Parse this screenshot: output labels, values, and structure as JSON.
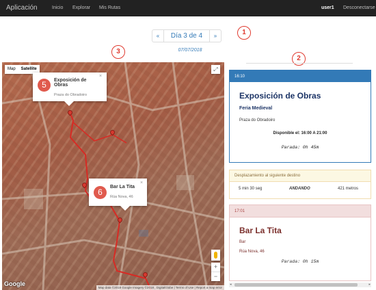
{
  "navbar": {
    "brand": "Aplicación",
    "links": [
      "Inicio",
      "Explorar",
      "Mis Rutas"
    ],
    "user": "user1",
    "logout": "Desconectarse"
  },
  "pager": {
    "prev": "«",
    "label": "Día 3 de 4",
    "next": "»"
  },
  "date": "07/07/2018",
  "callouts": [
    "1",
    "2",
    "3"
  ],
  "map": {
    "type_options": [
      "Map",
      "Satellite"
    ],
    "selected_type": "Satellite",
    "zoom_in": "+",
    "zoom_out": "−",
    "google": "Google",
    "attribution": "Map data ©2018 Google Imagery ©2018 , DigitalGlobe | Terms of Use | Report a map error",
    "infowindows": [
      {
        "num": "5",
        "title": "Exposición de Obras",
        "subtitle": "Praza do Obradoiro",
        "close": "×"
      },
      {
        "num": "6",
        "title": "Bar La Tita",
        "subtitle": "Rúa Nova, 46",
        "close": "×"
      }
    ]
  },
  "itinerary": {
    "event1": {
      "time": "16:10",
      "title": "Exposición de Obras",
      "category": "Feria Medieval",
      "address": "Praza do Obradoiro",
      "availability": "Disponible el: 16:00 A 21:00",
      "stop": "Parada: 0h 45m"
    },
    "travel": {
      "header": "Desplazamiento al siguiente destino",
      "duration": "5 min 30 seg",
      "mode": "ANDANDO",
      "distance": "421 metros"
    },
    "event2": {
      "time": "17:01",
      "title": "Bar La Tita",
      "category": "Bar",
      "address": "Rúa Nova, 46",
      "stop": "Parada: 0h 15m"
    }
  },
  "colors": {
    "primary": "#337ab7",
    "warning_bg": "#fcf8e3",
    "danger_bg": "#f2dede",
    "callout": "#e03a2f"
  }
}
